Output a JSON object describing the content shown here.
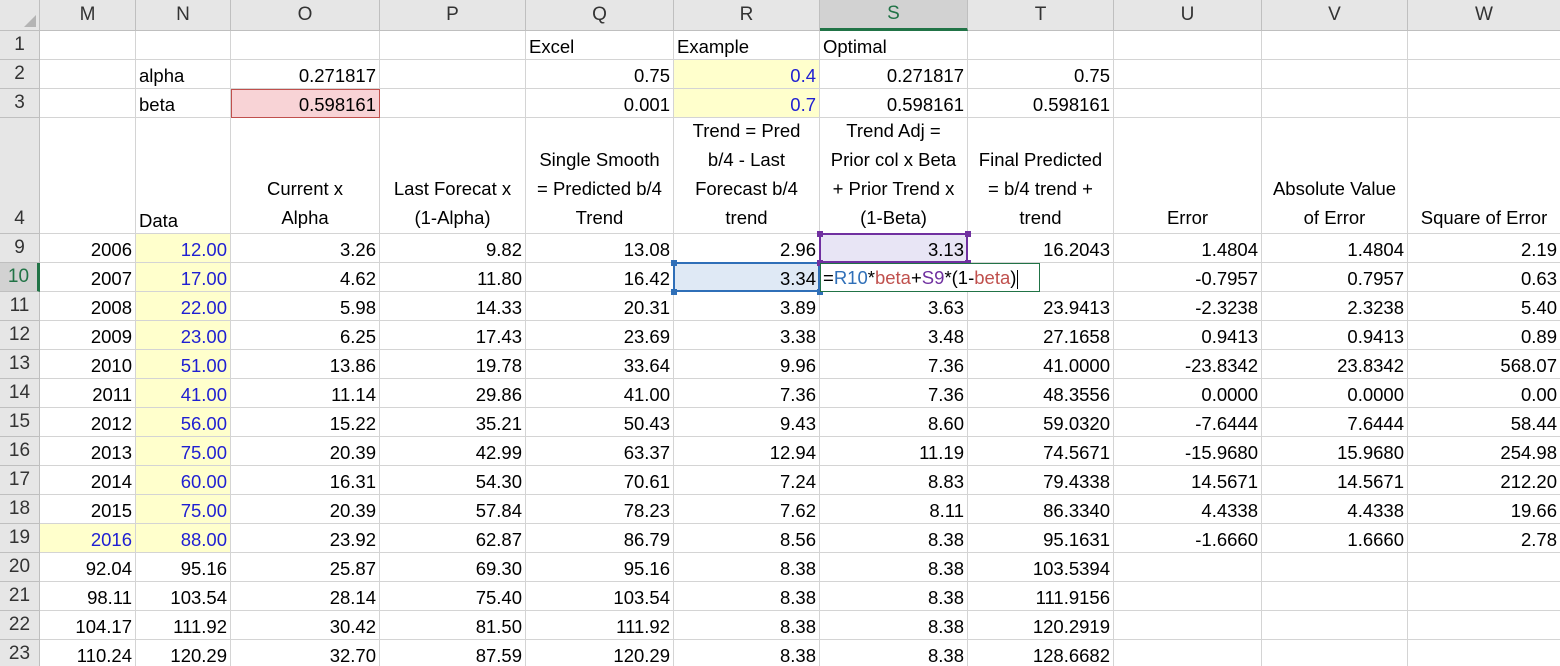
{
  "columns": [
    "M",
    "N",
    "O",
    "P",
    "Q",
    "R",
    "S",
    "T",
    "U",
    "V",
    "W"
  ],
  "selected_column": "S",
  "selected_row": "10",
  "rows": [
    {
      "num": "1",
      "cells": [
        "",
        "",
        "",
        "",
        "Excel",
        "Example",
        "Optimal",
        "",
        "",
        "",
        ""
      ]
    },
    {
      "num": "2",
      "cells": [
        "",
        "alpha",
        "0.271817",
        "",
        "0.75",
        "0.4",
        "0.271817",
        "0.75",
        "",
        "",
        ""
      ]
    },
    {
      "num": "3",
      "cells": [
        "",
        "beta",
        "0.598161",
        "",
        "0.001",
        "0.7",
        "0.598161",
        "0.598161",
        "",
        "",
        ""
      ]
    },
    {
      "num": "4",
      "cells": [
        "",
        "Data",
        "Current x\nAlpha",
        "Last Forecat x\n(1-Alpha)",
        "Single Smooth\n= Predicted b/4\nTrend",
        "Trend = Pred\nb/4 - Last\nForecast b/4\ntrend",
        "Trend Adj =\nPrior col x Beta\n+ Prior Trend x\n(1-Beta)",
        "Final Predicted\n= b/4 trend +\ntrend",
        "Error",
        "Absolute Value\nof Error",
        "Square of Error"
      ]
    },
    {
      "num": "9",
      "cells": [
        "2006",
        "12.00",
        "3.26",
        "9.82",
        "13.08",
        "2.96",
        "3.13",
        "16.2043",
        "1.4804",
        "1.4804",
        "2.19"
      ]
    },
    {
      "num": "10",
      "cells": [
        "2007",
        "17.00",
        "4.62",
        "11.80",
        "16.42",
        "3.34",
        "",
        "",
        "-0.7957",
        "0.7957",
        "0.63"
      ]
    },
    {
      "num": "11",
      "cells": [
        "2008",
        "22.00",
        "5.98",
        "14.33",
        "20.31",
        "3.89",
        "3.63",
        "23.9413",
        "-2.3238",
        "2.3238",
        "5.40"
      ]
    },
    {
      "num": "12",
      "cells": [
        "2009",
        "23.00",
        "6.25",
        "17.43",
        "23.69",
        "3.38",
        "3.48",
        "27.1658",
        "0.9413",
        "0.9413",
        "0.89"
      ]
    },
    {
      "num": "13",
      "cells": [
        "2010",
        "51.00",
        "13.86",
        "19.78",
        "33.64",
        "9.96",
        "7.36",
        "41.0000",
        "-23.8342",
        "23.8342",
        "568.07"
      ]
    },
    {
      "num": "14",
      "cells": [
        "2011",
        "41.00",
        "11.14",
        "29.86",
        "41.00",
        "7.36",
        "7.36",
        "48.3556",
        "0.0000",
        "0.0000",
        "0.00"
      ]
    },
    {
      "num": "15",
      "cells": [
        "2012",
        "56.00",
        "15.22",
        "35.21",
        "50.43",
        "9.43",
        "8.60",
        "59.0320",
        "-7.6444",
        "7.6444",
        "58.44"
      ]
    },
    {
      "num": "16",
      "cells": [
        "2013",
        "75.00",
        "20.39",
        "42.99",
        "63.37",
        "12.94",
        "11.19",
        "74.5671",
        "-15.9680",
        "15.9680",
        "254.98"
      ]
    },
    {
      "num": "17",
      "cells": [
        "2014",
        "60.00",
        "16.31",
        "54.30",
        "70.61",
        "7.24",
        "8.83",
        "79.4338",
        "14.5671",
        "14.5671",
        "212.20"
      ]
    },
    {
      "num": "18",
      "cells": [
        "2015",
        "75.00",
        "20.39",
        "57.84",
        "78.23",
        "7.62",
        "8.11",
        "86.3340",
        "4.4338",
        "4.4338",
        "19.66"
      ]
    },
    {
      "num": "19",
      "cells": [
        "2016",
        "88.00",
        "23.92",
        "62.87",
        "86.79",
        "8.56",
        "8.38",
        "95.1631",
        "-1.6660",
        "1.6660",
        "2.78"
      ]
    },
    {
      "num": "20",
      "cells": [
        "92.04",
        "95.16",
        "25.87",
        "69.30",
        "95.16",
        "8.38",
        "8.38",
        "103.5394",
        "",
        "",
        ""
      ]
    },
    {
      "num": "21",
      "cells": [
        "98.11",
        "103.54",
        "28.14",
        "75.40",
        "103.54",
        "8.38",
        "8.38",
        "111.9156",
        "",
        "",
        ""
      ]
    },
    {
      "num": "22",
      "cells": [
        "104.17",
        "111.92",
        "30.42",
        "81.50",
        "111.92",
        "8.38",
        "8.38",
        "120.2919",
        "",
        "",
        ""
      ]
    },
    {
      "num": "23",
      "cells": [
        "110.24",
        "120.29",
        "32.70",
        "87.59",
        "120.29",
        "8.38",
        "8.38",
        "128.6682",
        "",
        "",
        ""
      ]
    }
  ],
  "formula": {
    "cell": "S10",
    "tokens": [
      {
        "text": "=",
        "kind": "op"
      },
      {
        "text": "R10",
        "kind": "ref-r"
      },
      {
        "text": "*",
        "kind": "op"
      },
      {
        "text": "beta",
        "kind": "name"
      },
      {
        "text": "+",
        "kind": "op"
      },
      {
        "text": "S9",
        "kind": "ref-s"
      },
      {
        "text": "*",
        "kind": "op"
      },
      {
        "text": "(1-",
        "kind": "op"
      },
      {
        "text": "beta",
        "kind": "name"
      },
      {
        "text": ")",
        "kind": "op"
      }
    ]
  },
  "colors": {
    "yellow_fill": "#ffffcc",
    "pink_fill": "#f8d3d6",
    "blue_text": "#1f1fd2",
    "excel_green": "#217346",
    "ref_blue": "#2f6fb8",
    "ref_purple": "#7030a0",
    "name_red": "#c0504d"
  }
}
